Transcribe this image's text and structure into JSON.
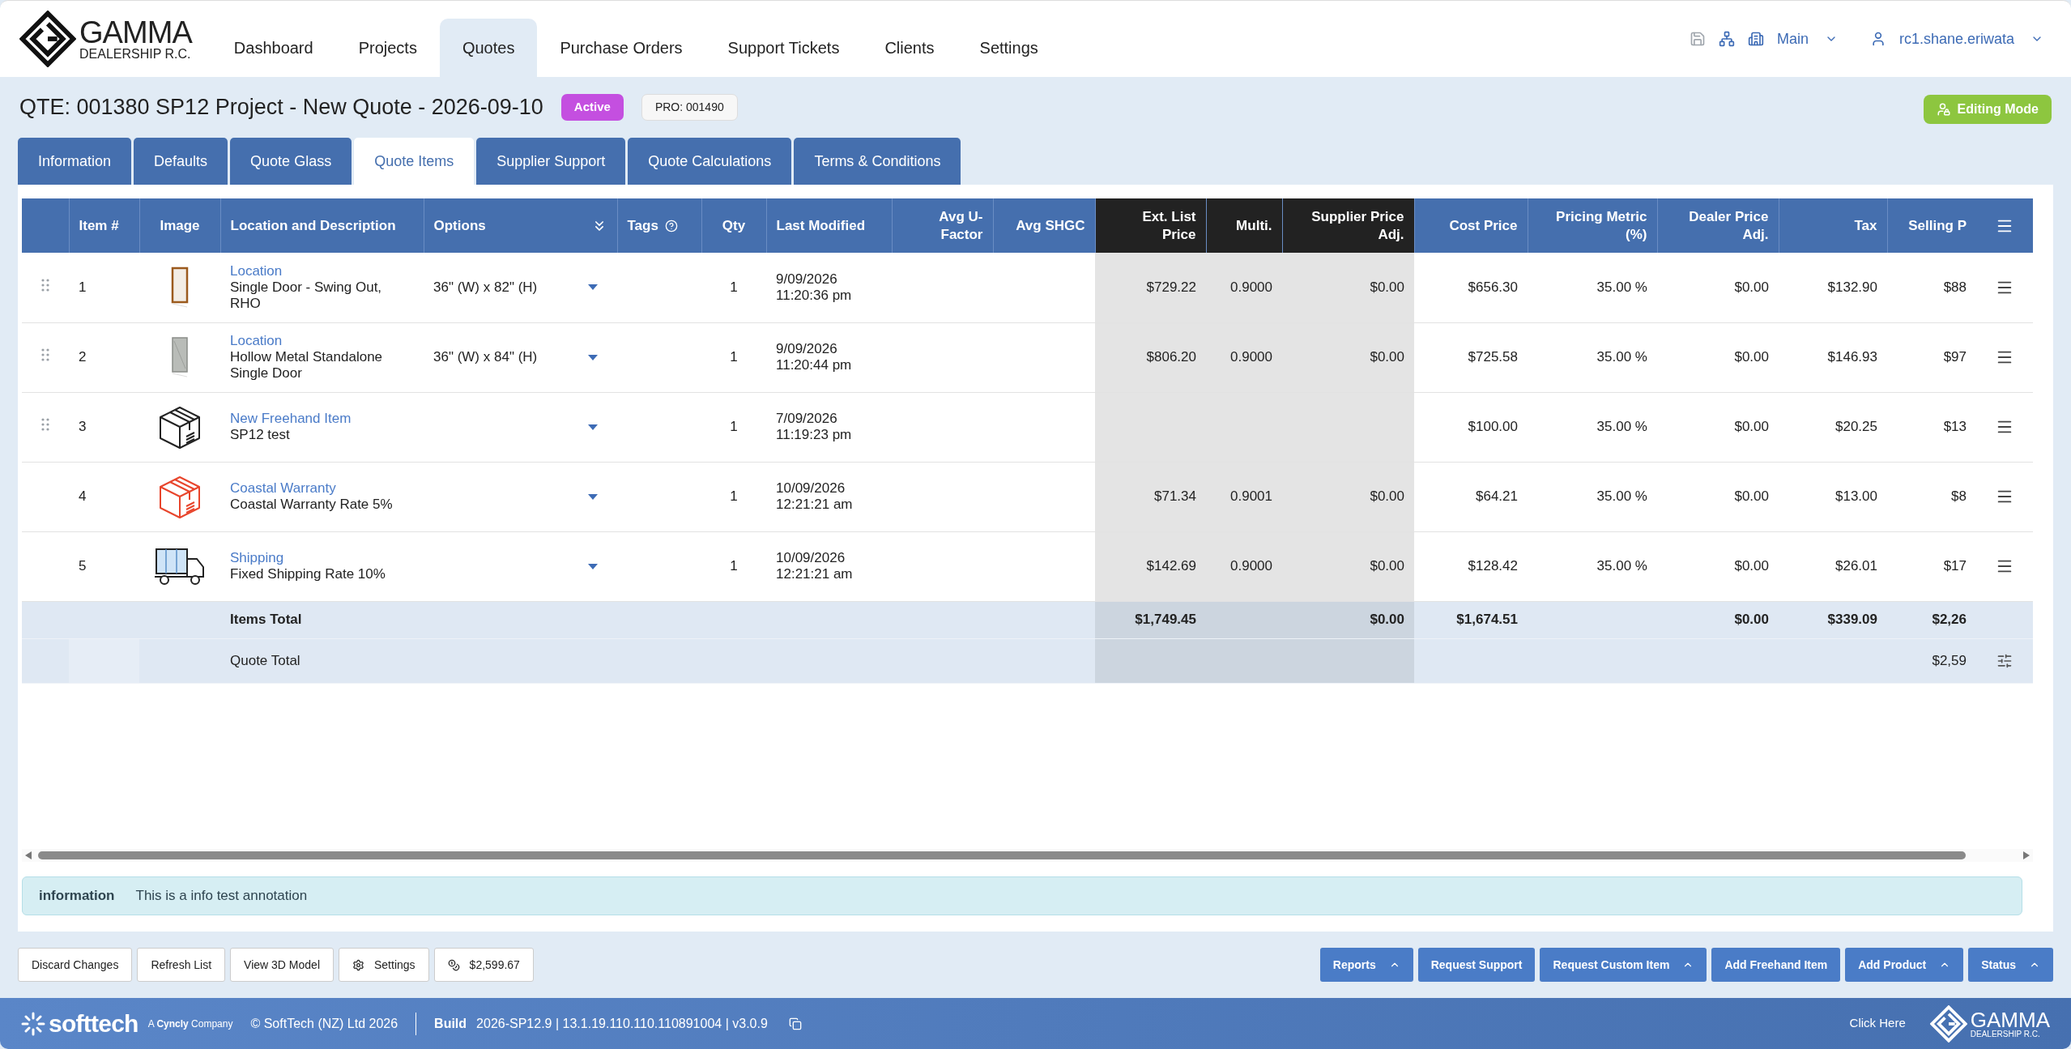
{
  "brand": {
    "name": "GAMMA",
    "subtitle": "DEALERSHIP R.C."
  },
  "nav": [
    {
      "label": "Dashboard",
      "selected": false
    },
    {
      "label": "Projects",
      "selected": false
    },
    {
      "label": "Quotes",
      "selected": true
    },
    {
      "label": "Purchase Orders",
      "selected": false
    },
    {
      "label": "Support Tickets",
      "selected": false
    },
    {
      "label": "Clients",
      "selected": false
    },
    {
      "label": "Settings",
      "selected": false
    }
  ],
  "account": {
    "branch": "Main",
    "user": "rc1.shane.eriwata"
  },
  "quote": {
    "title": "QTE: 001380 SP12 Project - New Quote - 2026-09-10",
    "status": "Active",
    "project": "PRO: 001490",
    "mode": "Editing Mode"
  },
  "tabs": [
    {
      "label": "Information",
      "selected": false
    },
    {
      "label": "Defaults",
      "selected": false
    },
    {
      "label": "Quote Glass",
      "selected": false
    },
    {
      "label": "Quote Items",
      "selected": true
    },
    {
      "label": "Supplier Support",
      "selected": false
    },
    {
      "label": "Quote Calculations",
      "selected": false
    },
    {
      "label": "Terms & Conditions",
      "selected": false
    }
  ],
  "table": {
    "columns": [
      {
        "label": "Item #",
        "kind": "index"
      },
      {
        "label": "Image",
        "kind": "image"
      },
      {
        "label": "Location and Description",
        "kind": "description"
      },
      {
        "label": "Options",
        "kind": "options"
      },
      {
        "label": "Tags",
        "kind": "tags"
      },
      {
        "label": "Qty",
        "kind": "qty"
      },
      {
        "label": "Last Modified",
        "kind": "date"
      },
      {
        "label": "Avg U-Factor",
        "kind": "plain"
      },
      {
        "label": "Avg SHGC",
        "kind": "plain"
      },
      {
        "label": "Ext. List Price",
        "kind": "supplier"
      },
      {
        "label": "Multi.",
        "kind": "supplier"
      },
      {
        "label": "Supplier Price Adj.",
        "kind": "supplier"
      },
      {
        "label": "Cost Price",
        "kind": "price"
      },
      {
        "label": "Pricing Metric (%)",
        "kind": "price"
      },
      {
        "label": "Dealer Price Adj.",
        "kind": "price"
      },
      {
        "label": "Tax",
        "kind": "price"
      },
      {
        "label": "Selling P",
        "kind": "price"
      }
    ],
    "rows": [
      {
        "item": "1",
        "kind": "wood_door",
        "draggable": true,
        "location": "Location",
        "description": "Single Door - Swing Out, RHO",
        "options": "36\" (W) x 82\" (H)",
        "qty": "1",
        "date": "9/09/2026",
        "time": "11:20:36 pm",
        "prices": {
          "ext_list": "$729.22",
          "multi": "0.9000",
          "supplier_adj": "$0.00",
          "cost": "$656.30",
          "pricing_metric": "35.00 %",
          "dealer_adj": "$0.00",
          "tax": "$132.90",
          "selling": "$88"
        }
      },
      {
        "item": "2",
        "kind": "metal_door",
        "draggable": true,
        "location": "Location",
        "description": "Hollow Metal Standalone Single Door",
        "options": "36\" (W) x 84\" (H)",
        "qty": "1",
        "date": "9/09/2026",
        "time": "11:20:44 pm",
        "prices": {
          "ext_list": "$806.20",
          "multi": "0.9000",
          "supplier_adj": "$0.00",
          "cost": "$725.58",
          "pricing_metric": "35.00 %",
          "dealer_adj": "$0.00",
          "tax": "$146.93",
          "selling": "$97"
        }
      },
      {
        "item": "3",
        "kind": "box",
        "draggable": true,
        "location": "New Freehand Item",
        "description": "SP12 test",
        "qty": "1",
        "date": "7/09/2026",
        "time": "11:19:23 pm",
        "prices": {
          "cost": "$100.00",
          "pricing_metric": "35.00 %",
          "dealer_adj": "$0.00",
          "tax": "$20.25",
          "selling": "$13"
        }
      },
      {
        "item": "4",
        "kind": "red_box",
        "draggable": false,
        "location": "Coastal Warranty",
        "description": "Coastal Warranty Rate 5%",
        "qty": "1",
        "date": "10/09/2026",
        "time": "12:21:21 am",
        "prices": {
          "ext_list": "$71.34",
          "multi": "0.9001",
          "supplier_adj": "$0.00",
          "cost": "$64.21",
          "pricing_metric": "35.00 %",
          "dealer_adj": "$0.00",
          "tax": "$13.00",
          "selling": "$8"
        }
      },
      {
        "item": "5",
        "kind": "truck",
        "draggable": false,
        "location": "Shipping",
        "description": "Fixed Shipping Rate 10%",
        "qty": "1",
        "date": "10/09/2026",
        "time": "12:21:21 am",
        "prices": {
          "ext_list": "$142.69",
          "multi": "0.9000",
          "supplier_adj": "$0.00",
          "cost": "$128.42",
          "pricing_metric": "35.00 %",
          "dealer_adj": "$0.00",
          "tax": "$26.01",
          "selling": "$17"
        }
      }
    ],
    "totals": [
      {
        "label": "Items Total",
        "kind": "items",
        "prices": {
          "ext_list": "$1,749.45",
          "supplier_adj": "$0.00",
          "cost": "$1,674.51",
          "dealer_adj": "$0.00",
          "tax": "$339.09",
          "selling": "$2,26"
        }
      },
      {
        "label": "Quote Total",
        "kind": "quote",
        "prices": {
          "selling": "$2,59"
        }
      }
    ]
  },
  "annotation": {
    "type": "information",
    "text": "This is a info test annotation"
  },
  "actions_left": [
    {
      "label": "Discard Changes",
      "kind": "plain"
    },
    {
      "label": "Refresh List",
      "kind": "plain"
    },
    {
      "label": "View 3D Model",
      "kind": "plain"
    },
    {
      "label": "Settings",
      "kind": "settings"
    },
    {
      "label": "$2,599.67",
      "kind": "total"
    }
  ],
  "actions_right": [
    {
      "label": "Reports",
      "menu": true
    },
    {
      "label": "Request Support",
      "menu": false
    },
    {
      "label": "Request Custom Item",
      "menu": true
    },
    {
      "label": "Add Freehand Item",
      "menu": false
    },
    {
      "label": "Add Product",
      "menu": true
    },
    {
      "label": "Status",
      "menu": true
    }
  ],
  "footer": {
    "brand": "softtech",
    "tagline": "A **Cyncly** Company",
    "copyright": "© SoftTech (NZ) Ltd 2026",
    "build_label": "Build",
    "build": "2026-SP12.9 | 13.1.19.110.110.110891004 | v3.0.9",
    "link": "Click Here",
    "logo_name": "GAMMA",
    "logo_subtitle": "DEALERSHIP R.C."
  }
}
